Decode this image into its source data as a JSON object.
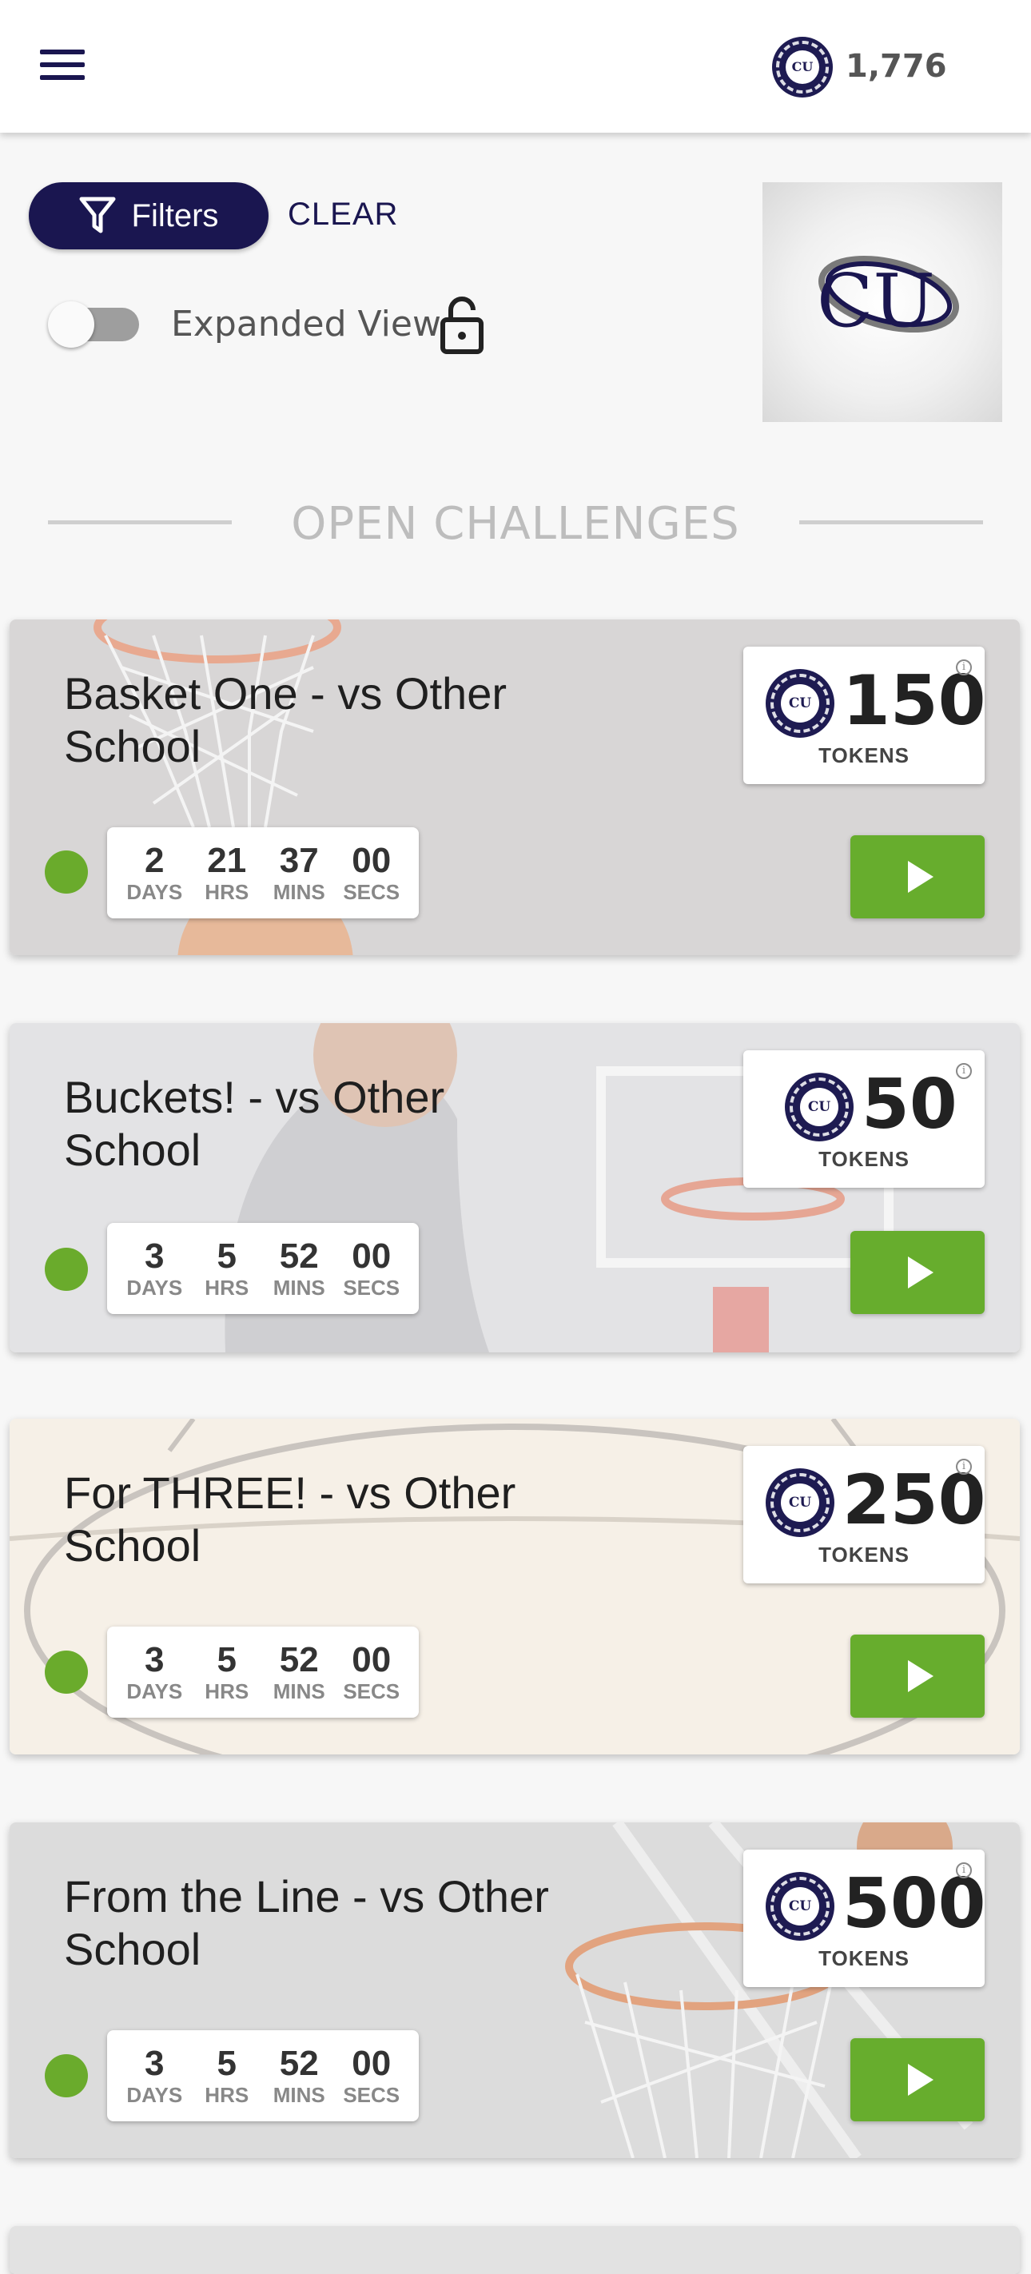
{
  "header": {
    "coin_text": "CU",
    "balance": "1,776"
  },
  "filters": {
    "button_label": "Filters",
    "clear_label": "CLEAR",
    "expanded_view_label": "Expanded View",
    "expanded_view_on": false
  },
  "logo": {
    "text": "CU"
  },
  "section": {
    "title": "OPEN CHALLENGES"
  },
  "colors": {
    "navy": "#1a1650",
    "green": "#67ad2d",
    "background": "#f7f7f7"
  },
  "icons": [
    "menu-icon",
    "filter-icon",
    "lock-icon",
    "coin-icon",
    "info-icon",
    "play-icon"
  ],
  "countdown_labels": {
    "days": "DAYS",
    "hrs": "HRS",
    "mins": "MINS",
    "secs": "SECS"
  },
  "tokens_label": "TOKENS",
  "challenges": [
    {
      "title": "Basket One - vs Other School",
      "tokens": "150",
      "days": "2",
      "hrs": "21",
      "mins": "37",
      "secs": "00"
    },
    {
      "title": "Buckets! - vs Other School",
      "tokens": "50",
      "days": "3",
      "hrs": "5",
      "mins": "52",
      "secs": "00"
    },
    {
      "title": "For THREE! - vs Other School",
      "tokens": "250",
      "days": "3",
      "hrs": "5",
      "mins": "52",
      "secs": "00"
    },
    {
      "title": "From the Line - vs Other School",
      "tokens": "500",
      "days": "3",
      "hrs": "5",
      "mins": "52",
      "secs": "00"
    }
  ]
}
